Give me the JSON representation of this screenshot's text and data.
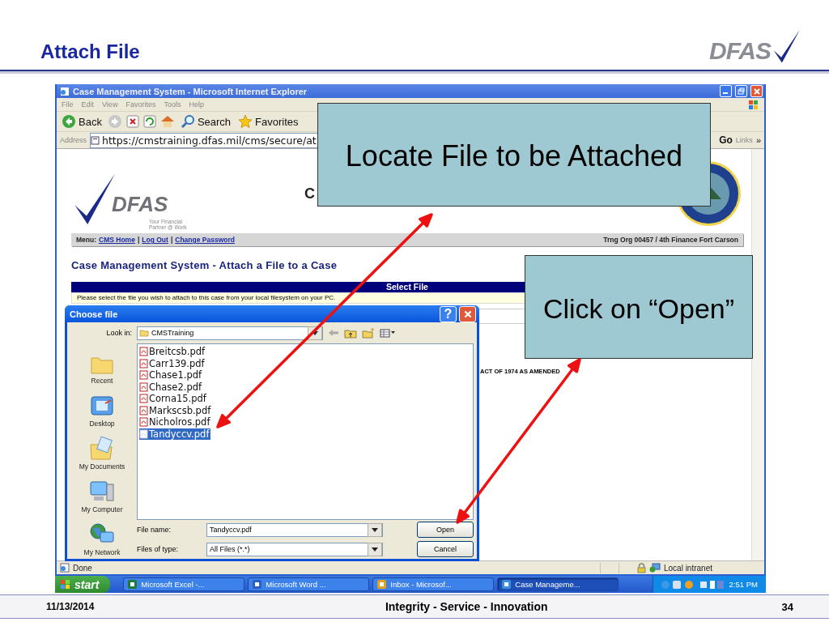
{
  "slide": {
    "title": "Attach File",
    "logo": "DFAS",
    "date": "11/13/2014",
    "tagline": "Integrity - Service - Innovation",
    "page_number": "34"
  },
  "browser": {
    "title": "Case Management System - Microsoft Internet Explorer",
    "menu": [
      "File",
      "Edit",
      "View",
      "Favorites",
      "Tools",
      "Help"
    ],
    "toolbar": [
      {
        "kind": "back",
        "label": "Back"
      },
      {
        "kind": "forward"
      },
      {
        "kind": "stop"
      },
      {
        "kind": "refresh"
      },
      {
        "kind": "home"
      },
      {
        "kind": "search",
        "label": "Search"
      },
      {
        "kind": "favorites",
        "label": "Favorites"
      }
    ],
    "address_label": "Address",
    "address": "https://cmstraining.dfas.mil/cms/secure/at",
    "go": "Go",
    "links": "Links",
    "links_more": "»",
    "status": "Done",
    "zone": "Local intranet"
  },
  "page": {
    "logo": "DFAS",
    "logo_tagline": "Your Financial Partner @ Work",
    "title_fragment": "C",
    "menu_label": "Menu:",
    "menu_separator": "|",
    "menu_links": [
      "CMS Home",
      "Log Out",
      "Change Password"
    ],
    "org": "Trng Org 00457 / 4th Finance Fort Carson",
    "heading": "Case Management System - Attach a File to a Case",
    "section": "Select File",
    "instruction": "Please select the file you wish to attach to this case from your local filesystem on your PC.",
    "notice": "ACT OF 1974 AS AMENDED"
  },
  "dialog": {
    "title": "Choose file",
    "help_button": "?",
    "look_in_label": "Look in:",
    "look_in": "CMSTraining",
    "places": [
      {
        "kind": "recent",
        "label": "Recent"
      },
      {
        "kind": "desktop",
        "label": "Desktop"
      },
      {
        "kind": "documents",
        "label": "My Documents"
      },
      {
        "kind": "computer",
        "label": "My Computer"
      },
      {
        "kind": "network",
        "label": "My Network"
      }
    ],
    "files": [
      {
        "name": "Breitcsb.pdf",
        "selected": false
      },
      {
        "name": "Carr139.pdf",
        "selected": false
      },
      {
        "name": "Chase1.pdf",
        "selected": false
      },
      {
        "name": "Chase2.pdf",
        "selected": false
      },
      {
        "name": "Corna15.pdf",
        "selected": false
      },
      {
        "name": "Markscsb.pdf",
        "selected": false
      },
      {
        "name": "Nicholros.pdf",
        "selected": false
      },
      {
        "name": "Tandyccv.pdf",
        "selected": true
      }
    ],
    "file_name_label": "File name:",
    "file_name": "Tandyccv.pdf",
    "file_type_label": "Files of type:",
    "file_type": "All Files (*.*)",
    "buttons": [
      "Open",
      "Cancel"
    ]
  },
  "callouts": [
    {
      "text": "Locate File to be Attached"
    },
    {
      "text": "Click on “Open”"
    }
  ],
  "taskbar": {
    "start": "start",
    "tasks": [
      {
        "kind": "excel",
        "label": "Microsoft Excel -...",
        "selected": false
      },
      {
        "kind": "word",
        "label": "Microsoft Word ...",
        "selected": false
      },
      {
        "kind": "outlook",
        "label": "Inbox - Microsof...",
        "selected": false
      },
      {
        "kind": "ie",
        "label": "Case Manageme...",
        "selected": true
      }
    ],
    "clock": "2:51 PM"
  }
}
